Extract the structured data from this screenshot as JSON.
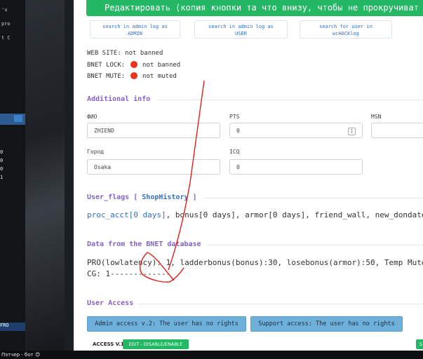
{
  "top_button": {
    "label": "Редактировать (копия кнопки та что внизу, чтобы не прокручиват"
  },
  "search_buttons": [
    {
      "line1": "search in admin log as",
      "line2": "ADMIN"
    },
    {
      "line1": "search in admin log as",
      "line2": "USER"
    },
    {
      "line1": "search for user in",
      "line2": "wcHACKlog"
    }
  ],
  "status": {
    "website": "WEB SITE: not banned",
    "bnet_lock_label": "BNET LOCK:",
    "bnet_lock_value": "not banned",
    "bnet_mute_label": "BNET MUTE:",
    "bnet_mute_value": "not muted"
  },
  "additional_info": {
    "title": "Additional info",
    "fio_label": "ФИО",
    "fio_value": "ZHIEND",
    "pts_label": "PTS",
    "pts_value": "0",
    "msn_label": "MSN",
    "city_label": "Город",
    "city_value": "Osaka",
    "icq_label": "ICQ",
    "icq_value": "0"
  },
  "user_flags": {
    "title": "User_flags [",
    "shop": "ShopHistory",
    "title_end": "]",
    "link": "proc_acct[0 days]",
    "rest": ", bonus[0 days], armor[0 days], friend_wall, new_dondate"
  },
  "bnet": {
    "title": "Data from the BNET database",
    "line1": "PRO(lowlatency): 1, ladderbonus(bonus):30, losebonus(armor):50, Temp Mute:",
    "line2": "CG: 1-------------"
  },
  "user_access": {
    "title": "User Access",
    "admin_button": "Admin access v.2: The user has no rights",
    "support_button": "Support access: The user has no rights",
    "access_label": "ACCESS V.1",
    "edit_button": "EDIT - DISABLE/ENABLE",
    "right_button": "S"
  },
  "background": {
    "snippets": [
      "'u",
      "pro",
      "t C",
      "0",
      "0",
      "0",
      "1",
      "FRO"
    ],
    "bottom_text": "Пэтчер - бот 😊"
  },
  "colors": {
    "accent_green": "#25b864",
    "section_purple": "#8462c7",
    "link_blue": "#2f6fd0",
    "access_blue": "#6fb0da",
    "dot_red": "#e8341c",
    "annotation_red": "#e0201a"
  }
}
